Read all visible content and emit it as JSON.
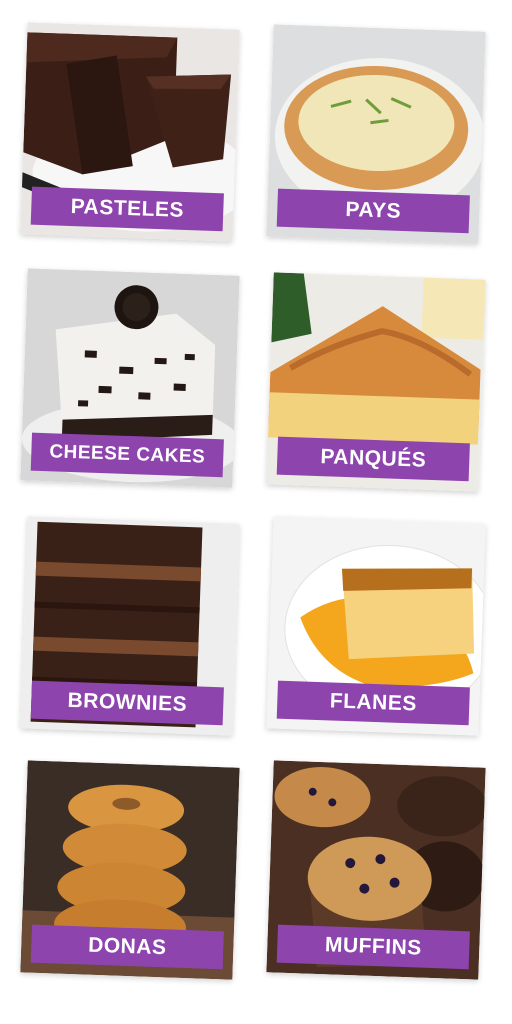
{
  "categories": [
    {
      "label": "PASTELES",
      "image": "chocolate-cake-image"
    },
    {
      "label": "PAYS",
      "image": "lime-pie-image"
    },
    {
      "label": "CHEESE CAKES",
      "image": "oreo-cheesecake-image"
    },
    {
      "label": "PANQUÉS",
      "image": "pound-cake-image"
    },
    {
      "label": "BROWNIES",
      "image": "brownies-image"
    },
    {
      "label": "FLANES",
      "image": "flan-image"
    },
    {
      "label": "DONAS",
      "image": "donuts-image"
    },
    {
      "label": "MUFFINS",
      "image": "muffins-image"
    }
  ],
  "colors": {
    "label_background": "#8e44ad",
    "label_text": "#ffffff"
  }
}
